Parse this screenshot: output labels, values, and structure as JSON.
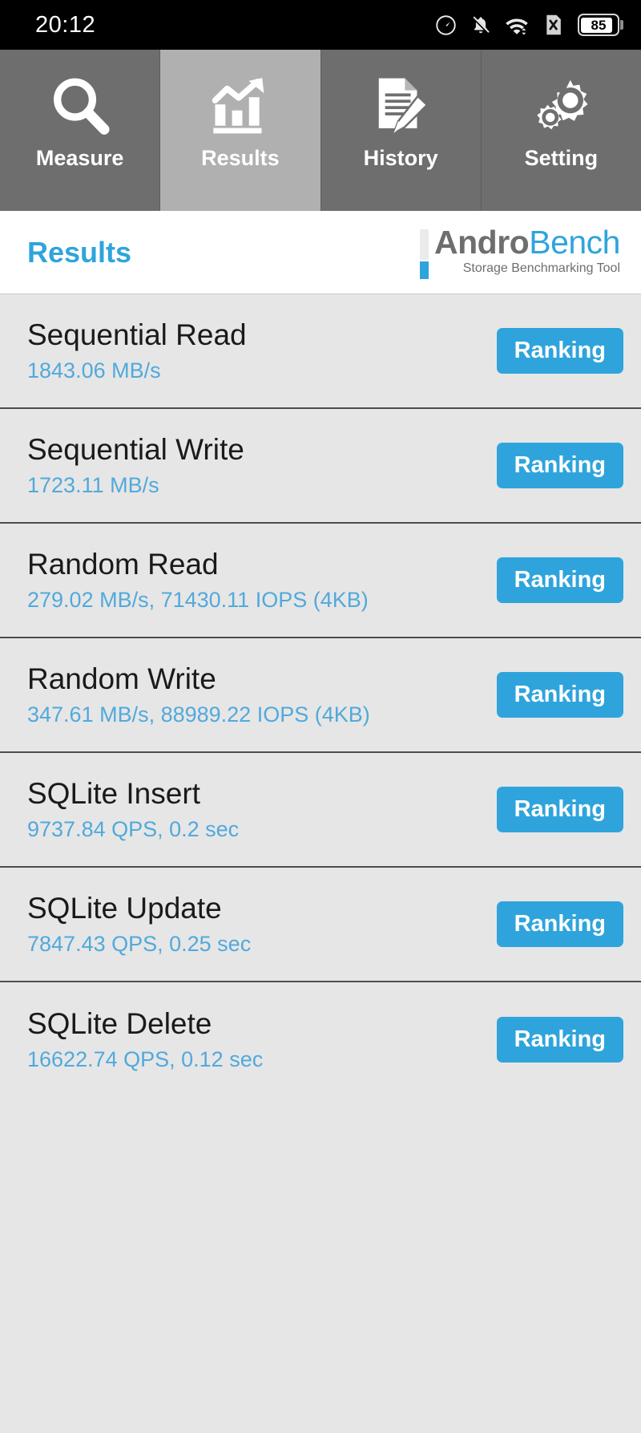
{
  "statusbar": {
    "clock": "20:12",
    "battery_percent": "85",
    "icons": [
      "data-saver-icon",
      "notifications-muted-icon",
      "wifi-icon",
      "no-sim-icon",
      "battery-icon"
    ]
  },
  "tabs": [
    {
      "label": "Measure",
      "icon": "magnifier-icon",
      "selected": false
    },
    {
      "label": "Results",
      "icon": "bar-chart-arrow-icon",
      "selected": true
    },
    {
      "label": "History",
      "icon": "document-pencil-icon",
      "selected": false
    },
    {
      "label": "Setting",
      "icon": "gears-icon",
      "selected": false
    }
  ],
  "header": {
    "title": "Results",
    "logo_primary": "Andro",
    "logo_secondary": "Bench",
    "logo_subtitle": "Storage Benchmarking Tool"
  },
  "results": [
    {
      "name": "Sequential Read",
      "value": "1843.06 MB/s",
      "button": "Ranking"
    },
    {
      "name": "Sequential Write",
      "value": "1723.11 MB/s",
      "button": "Ranking"
    },
    {
      "name": "Random Read",
      "value": "279.02 MB/s, 71430.11 IOPS (4KB)",
      "button": "Ranking"
    },
    {
      "name": "Random Write",
      "value": "347.61 MB/s, 88989.22 IOPS (4KB)",
      "button": "Ranking"
    },
    {
      "name": "SQLite Insert",
      "value": "9737.84 QPS, 0.2 sec",
      "button": "Ranking"
    },
    {
      "name": "SQLite Update",
      "value": "7847.43 QPS, 0.25 sec",
      "button": "Ranking"
    },
    {
      "name": "SQLite Delete",
      "value": "16622.74 QPS, 0.12 sec",
      "button": "Ranking"
    }
  ],
  "colors": {
    "accent": "#2fa4dc",
    "value_text": "#51a9dc",
    "tab_bg": "#6e6e6e",
    "tab_selected_bg": "#b0b0b0",
    "list_bg": "#e6e6e6",
    "statusbar_bg": "#000000"
  }
}
